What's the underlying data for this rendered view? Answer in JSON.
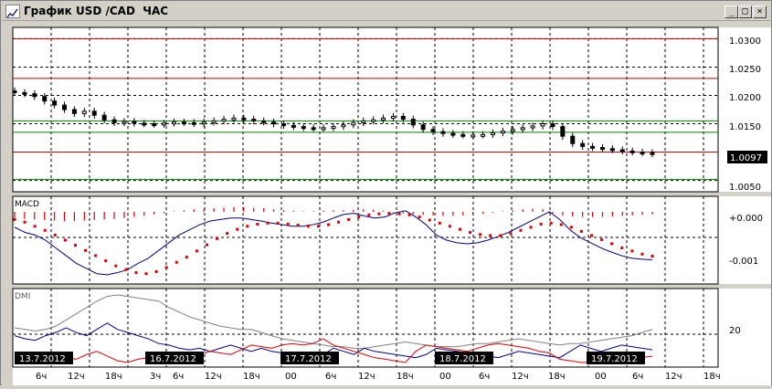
{
  "window": {
    "title": "График USD /CAD  ЧАС",
    "buttons": {
      "minimize": "_",
      "maximize": "□",
      "close": "×"
    }
  },
  "price_panel": {
    "axis_labels": [
      "1.0300",
      "1.0250",
      "1.0200",
      "1.0150",
      "1.0100",
      "1.0050"
    ],
    "current_price": "1.0097"
  },
  "macd_panel": {
    "title": "MACD",
    "axis_labels": [
      "+0.000",
      "-0.001"
    ]
  },
  "dmi_panel": {
    "title": "DMI",
    "axis_labels": [
      "20"
    ]
  },
  "time_axis": {
    "date_labels": [
      "13.7.2012",
      "16.7.2012",
      "17.7.2012",
      "18.7.2012",
      "19.7.2012"
    ],
    "hour_labels": [
      "6ч",
      "12ч",
      "18ч",
      "3ч",
      "6ч",
      "12ч",
      "18ч",
      "00",
      "6ч",
      "12ч",
      "18ч",
      "00",
      "6ч",
      "12ч",
      "18ч",
      "00",
      "6ч",
      "12ч",
      "18ч"
    ]
  },
  "colors": {
    "background": "#ffffff",
    "frame": "#d4d0c8",
    "grid": "#000000",
    "level_red": "#cc0000",
    "level_green": "#008000",
    "macd_hist": "#e00000",
    "macd_line": "#000080",
    "signal_dots": "#dd0000",
    "dmi_adx": "#808080",
    "dmi_plus": "#000090",
    "dmi_minus": "#dd0000"
  },
  "chart_data": {
    "type": "candlestick",
    "symbol": "USD /CAD",
    "timeframe": "ЧАС",
    "x_dates": [
      "13.7.2012",
      "16.7.2012",
      "17.7.2012",
      "18.7.2012",
      "19.7.2012"
    ],
    "price_levels": {
      "red": [
        1.03,
        1.023,
        1.01
      ],
      "green": [
        1.0155,
        1.0135,
        1.0052
      ]
    },
    "price_ylim": [
      1.003,
      1.032
    ],
    "last_price": 1.0097,
    "close_series": [
      1.0205,
      1.0203,
      1.0198,
      1.019,
      1.0183,
      1.0175,
      1.0168,
      1.0172,
      1.0165,
      1.0157,
      1.0152,
      1.0154,
      1.0151,
      1.015,
      1.0149,
      1.0151,
      1.0153,
      1.0152,
      1.015,
      1.0153,
      1.0155,
      1.0158,
      1.016,
      1.0158,
      1.0155,
      1.0153,
      1.015,
      1.0147,
      1.0145,
      1.0143,
      1.0142,
      1.0143,
      1.0145,
      1.0148,
      1.0152,
      1.0155,
      1.0157,
      1.016,
      1.0163,
      1.0158,
      1.0148,
      1.014,
      1.0136,
      1.0133,
      1.0131,
      1.013,
      1.013,
      1.0131,
      1.0134,
      1.0137,
      1.014,
      1.0143,
      1.0146,
      1.015,
      1.0145,
      1.0128,
      1.0115,
      1.011,
      1.0108,
      1.0106,
      1.0104,
      1.0102,
      1.01,
      1.0099,
      1.0097
    ],
    "macd_ylim": [
      -0.0014,
      0.0003
    ],
    "macd_histogram": [
      -0.00012,
      -0.00014,
      -0.00015,
      -0.00016,
      -0.00017,
      -0.00018,
      -0.00018,
      -0.00017,
      -0.00016,
      -0.00015,
      -0.00014,
      -0.00012,
      -0.0001,
      -8e-05,
      -5e-05,
      -3e-05,
      1e-05,
      3e-05,
      5e-05,
      6e-05,
      7e-05,
      8e-05,
      9e-05,
      9e-05,
      8e-05,
      7e-05,
      5e-05,
      3e-05,
      2e-05,
      1e-05,
      1e-05,
      2e-05,
      3e-05,
      3e-05,
      4e-05,
      5e-05,
      4e-05,
      2e-05,
      -1e-05,
      -3e-05,
      -5e-05,
      -6e-05,
      -7e-05,
      -8e-05,
      -8e-05,
      -7e-05,
      -6e-05,
      -4e-05,
      -2e-05,
      1e-05,
      3e-05,
      5e-05,
      6e-05,
      5e-05,
      -3e-05,
      -7e-05,
      -9e-05,
      -0.0001,
      -0.0001,
      -0.0001,
      -9e-05,
      -8e-05,
      -7e-05,
      -6e-05,
      -5e-05
    ],
    "macd_line": [
      -0.0003,
      -0.0004,
      -0.00045,
      -0.00055,
      -0.0007,
      -0.00085,
      -0.001,
      -0.0011,
      -0.0012,
      -0.00122,
      -0.00118,
      -0.00112,
      -0.001,
      -0.0009,
      -0.00075,
      -0.0006,
      -0.00045,
      -0.00035,
      -0.00025,
      -0.00018,
      -0.00015,
      -0.00012,
      -0.00012,
      -0.00015,
      -0.00018,
      -0.00022,
      -0.00025,
      -0.00028,
      -0.00028,
      -0.00025,
      -0.0002,
      -0.00012,
      -5e-05,
      -3e-05,
      -8e-05,
      -0.00012,
      -0.0001,
      -2e-05,
      2e-05,
      -0.0001,
      -0.00025,
      -0.00045,
      -0.00055,
      -0.0006,
      -0.00062,
      -0.0006,
      -0.00055,
      -0.00048,
      -0.0004,
      -0.0003,
      -0.0002,
      -0.0001,
      0.0,
      -0.00015,
      -0.00035,
      -0.0005,
      -0.0006,
      -0.0007,
      -0.00078,
      -0.00085,
      -0.0009,
      -0.00092,
      -0.00093
    ],
    "signal_line": [
      -0.00015,
      -0.0002,
      -0.00028,
      -0.00036,
      -0.00045,
      -0.00055,
      -0.00065,
      -0.00075,
      -0.00085,
      -0.00095,
      -0.00105,
      -0.00112,
      -0.00118,
      -0.0012,
      -0.00116,
      -0.00108,
      -0.00098,
      -0.00088,
      -0.00076,
      -0.00064,
      -0.00052,
      -0.00042,
      -0.00034,
      -0.00028,
      -0.00024,
      -0.00022,
      -0.00022,
      -0.00024,
      -0.00026,
      -0.00028,
      -0.00028,
      -0.00025,
      -0.0002,
      -0.00015,
      -0.0001,
      -6e-05,
      -4e-05,
      -3e-05,
      -4e-05,
      -6e-05,
      -0.0001,
      -0.00016,
      -0.00022,
      -0.00028,
      -0.00034,
      -0.0004,
      -0.00044,
      -0.00046,
      -0.00046,
      -0.00042,
      -0.00036,
      -0.0003,
      -0.00024,
      -0.00022,
      -0.00025,
      -0.0003,
      -0.00038,
      -0.00046,
      -0.00054,
      -0.00062,
      -0.0007,
      -0.00076,
      -0.00082,
      -0.00086
    ],
    "dmi_ylim": [
      0,
      50
    ],
    "dmi_adx": [
      25,
      24,
      23,
      24,
      26,
      30,
      34,
      38,
      42,
      45,
      46,
      45,
      44,
      43,
      42,
      38,
      35,
      32,
      30,
      28,
      26,
      25,
      24,
      24,
      22,
      20,
      18,
      17,
      16,
      15,
      14,
      13,
      13,
      12,
      12,
      13,
      14,
      15,
      16,
      15,
      14,
      13,
      13,
      13,
      14,
      15,
      15,
      16,
      17,
      18,
      17,
      16,
      15,
      14,
      15,
      15,
      16,
      17,
      18,
      19,
      20,
      22,
      24
    ],
    "dmi_plus": [
      20,
      18,
      17,
      20,
      22,
      25,
      22,
      20,
      24,
      28,
      24,
      22,
      20,
      18,
      15,
      14,
      12,
      11,
      12,
      10,
      12,
      14,
      12,
      10,
      12,
      10,
      9,
      8,
      7,
      6,
      8,
      12,
      10,
      8,
      12,
      10,
      9,
      8,
      7,
      6,
      8,
      12,
      11,
      10,
      9,
      8,
      7,
      6,
      8,
      10,
      9,
      8,
      7,
      6,
      10,
      14,
      12,
      10,
      12,
      14,
      13,
      12,
      11
    ],
    "dmi_minus": [
      5,
      4,
      6,
      8,
      7,
      6,
      5,
      8,
      10,
      7,
      4,
      3,
      5,
      6,
      4,
      3,
      2,
      5,
      8,
      10,
      9,
      8,
      11,
      14,
      13,
      12,
      14,
      15,
      14,
      15,
      18,
      14,
      12,
      10,
      8,
      6,
      5,
      4,
      3,
      10,
      14,
      13,
      12,
      11,
      10,
      12,
      14,
      15,
      14,
      13,
      12,
      10,
      9,
      5,
      4,
      3,
      3,
      2,
      3,
      4,
      5,
      6,
      7
    ]
  }
}
